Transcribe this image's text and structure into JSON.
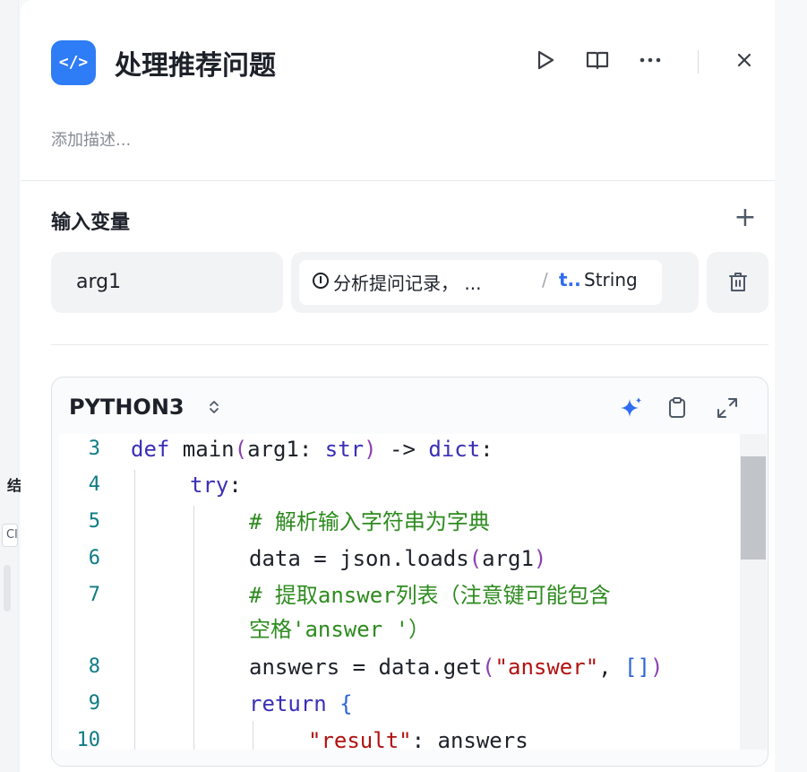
{
  "left_fragments": {
    "text1": "结",
    "text2": "Cl"
  },
  "header": {
    "icon_label": "</>",
    "title": "处理推荐问题",
    "description_placeholder": "添加描述..."
  },
  "inputs": {
    "section_title": "输入变量",
    "add_label": "+",
    "variables": [
      {
        "name": "arg1",
        "ref_icon": "I",
        "ref_source": "分析提问记录， ...",
        "ref_sep": "/",
        "ref_var": "t..",
        "ref_type": "String"
      }
    ]
  },
  "code": {
    "language": "PYTHON3",
    "language_caret": "⬍",
    "lines": [
      {
        "no": "3",
        "text": "def main(arg1: str) -> dict:"
      },
      {
        "no": "4",
        "text": "try:"
      },
      {
        "no": "5",
        "text": "# 解析输入字符串为字典"
      },
      {
        "no": "6",
        "text": "data = json.loads(arg1)"
      },
      {
        "no": "7",
        "text": "# 提取answer列表（注意键可能包含"
      },
      {
        "no": "",
        "text": "空格'answer '）"
      },
      {
        "no": "8",
        "text": "answers = data.get(\"answer\", [])"
      },
      {
        "no": "9",
        "text": "return {"
      },
      {
        "no": "10",
        "text": "\"result\": answers"
      }
    ]
  },
  "icons": {
    "play": "play-icon",
    "book": "book-icon",
    "more": "more-icon",
    "close": "close-icon",
    "delete": "trash-icon",
    "ai": "sparkle-icon",
    "copy": "clipboard-icon",
    "expand": "expand-icon"
  },
  "colors": {
    "accent": "#2e7cf6",
    "link": "#2e6cf0",
    "comment": "#2e8b1f",
    "keyword": "#3a2fb5",
    "string": "#b11212"
  }
}
